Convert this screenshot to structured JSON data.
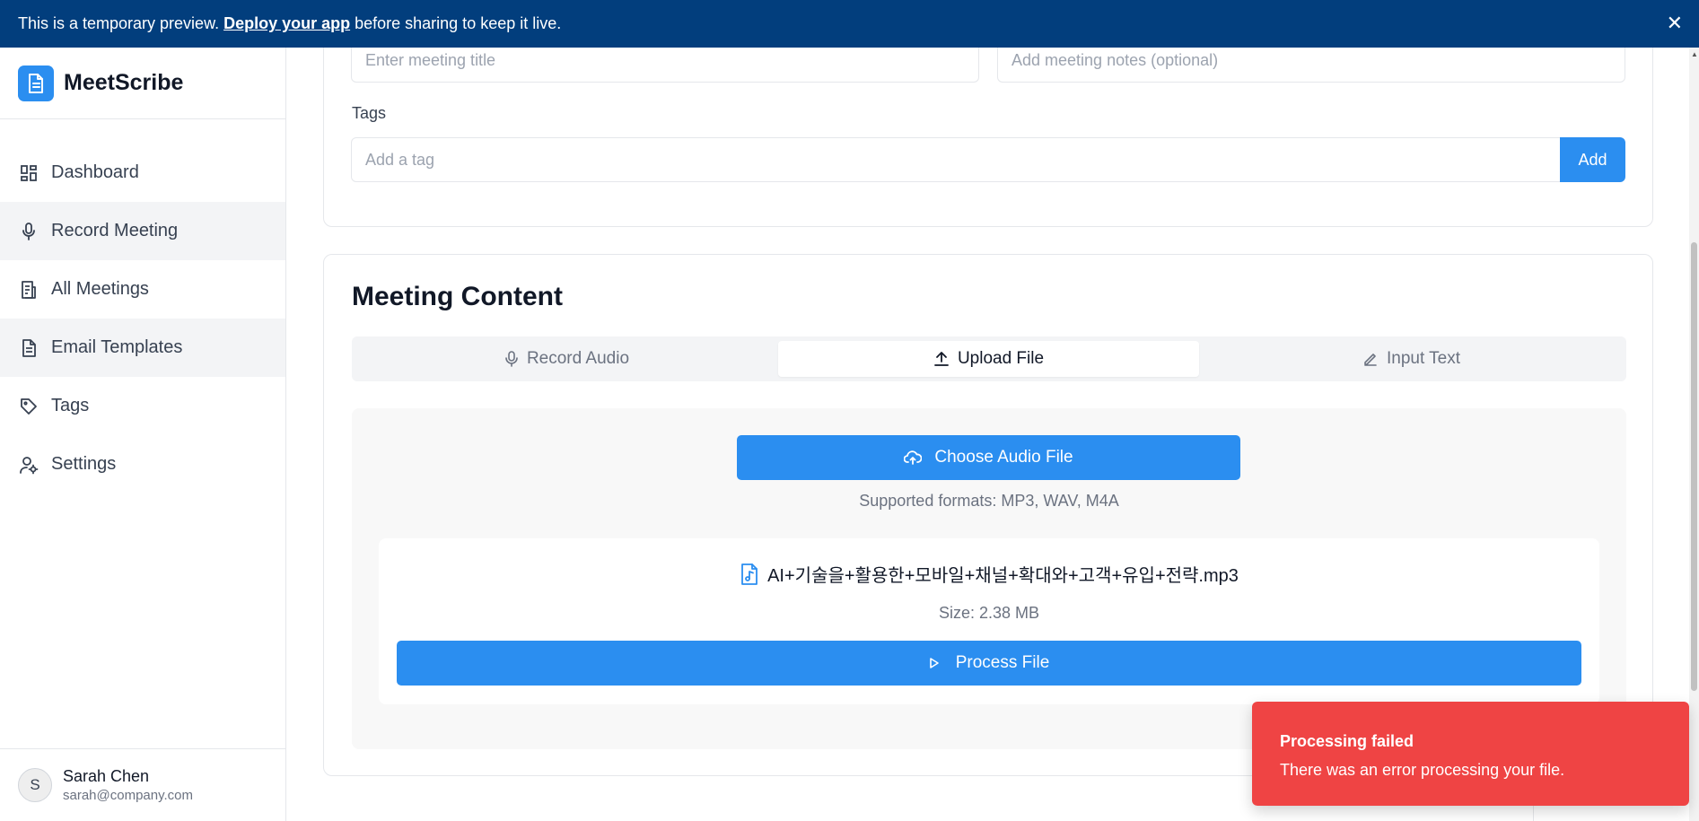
{
  "banner": {
    "text_before": "This is a temporary preview. ",
    "link": "Deploy your app",
    "text_after": " before sharing to keep it live.",
    "close": "✕"
  },
  "sidebar": {
    "brand": "MeetScribe",
    "items": [
      {
        "label": "Dashboard",
        "icon": "dashboard-icon"
      },
      {
        "label": "Record Meeting",
        "icon": "microphone-icon"
      },
      {
        "label": "All Meetings",
        "icon": "document-list-icon"
      },
      {
        "label": "Email Templates",
        "icon": "document-icon"
      },
      {
        "label": "Tags",
        "icon": "tag-icon"
      },
      {
        "label": "Settings",
        "icon": "user-settings-icon"
      }
    ],
    "user": {
      "initial": "S",
      "name": "Sarah Chen",
      "email": "sarah@company.com"
    }
  },
  "details": {
    "title_placeholder": "Enter meeting title",
    "notes_placeholder": "Add meeting notes (optional)",
    "tags_label": "Tags",
    "tag_placeholder": "Add a tag",
    "add_label": "Add"
  },
  "content": {
    "title": "Meeting Content",
    "tabs": [
      {
        "label": "Record Audio",
        "icon": "microphone-icon"
      },
      {
        "label": "Upload File",
        "icon": "upload-icon",
        "active": true
      },
      {
        "label": "Input Text",
        "icon": "pencil-icon"
      }
    ],
    "choose_label": "Choose Audio File",
    "formats": "Supported formats: MP3, WAV, M4A",
    "file": {
      "name": "AI+기술을+활용한+모바일+채널+확대와+고객+유입+전략.mp3",
      "size": "Size: 2.38 MB"
    },
    "process_label": "Process File"
  },
  "toast": {
    "title": "Processing failed",
    "description": "There was an error processing your file."
  },
  "colors": {
    "banner": "#023e7d",
    "primary": "#2b8ef0",
    "error": "#ef4444"
  }
}
